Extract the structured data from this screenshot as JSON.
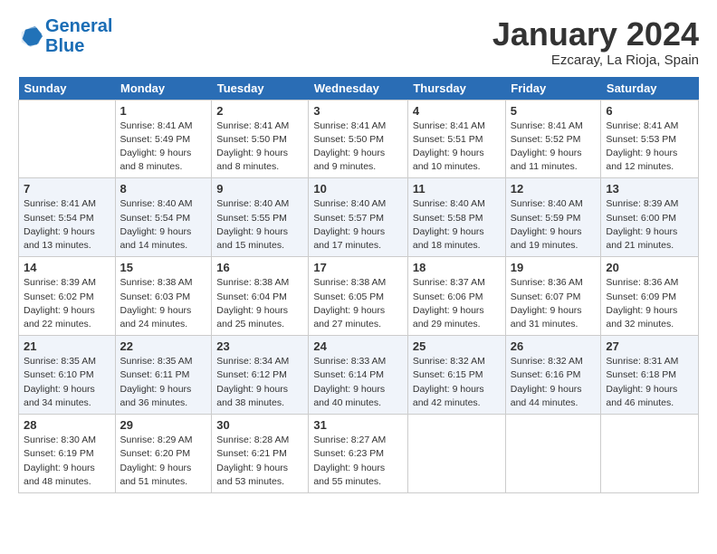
{
  "header": {
    "logo_line1": "General",
    "logo_line2": "Blue",
    "month_title": "January 2024",
    "location": "Ezcaray, La Rioja, Spain"
  },
  "weekdays": [
    "Sunday",
    "Monday",
    "Tuesday",
    "Wednesday",
    "Thursday",
    "Friday",
    "Saturday"
  ],
  "weeks": [
    [
      {
        "day": "",
        "info": ""
      },
      {
        "day": "1",
        "info": "Sunrise: 8:41 AM\nSunset: 5:49 PM\nDaylight: 9 hours\nand 8 minutes."
      },
      {
        "day": "2",
        "info": "Sunrise: 8:41 AM\nSunset: 5:50 PM\nDaylight: 9 hours\nand 8 minutes."
      },
      {
        "day": "3",
        "info": "Sunrise: 8:41 AM\nSunset: 5:50 PM\nDaylight: 9 hours\nand 9 minutes."
      },
      {
        "day": "4",
        "info": "Sunrise: 8:41 AM\nSunset: 5:51 PM\nDaylight: 9 hours\nand 10 minutes."
      },
      {
        "day": "5",
        "info": "Sunrise: 8:41 AM\nSunset: 5:52 PM\nDaylight: 9 hours\nand 11 minutes."
      },
      {
        "day": "6",
        "info": "Sunrise: 8:41 AM\nSunset: 5:53 PM\nDaylight: 9 hours\nand 12 minutes."
      }
    ],
    [
      {
        "day": "7",
        "info": ""
      },
      {
        "day": "8",
        "info": "Sunrise: 8:40 AM\nSunset: 5:54 PM\nDaylight: 9 hours\nand 14 minutes."
      },
      {
        "day": "9",
        "info": "Sunrise: 8:40 AM\nSunset: 5:55 PM\nDaylight: 9 hours\nand 15 minutes."
      },
      {
        "day": "10",
        "info": "Sunrise: 8:40 AM\nSunset: 5:57 PM\nDaylight: 9 hours\nand 17 minutes."
      },
      {
        "day": "11",
        "info": "Sunrise: 8:40 AM\nSunset: 5:58 PM\nDaylight: 9 hours\nand 18 minutes."
      },
      {
        "day": "12",
        "info": "Sunrise: 8:40 AM\nSunset: 5:59 PM\nDaylight: 9 hours\nand 19 minutes."
      },
      {
        "day": "13",
        "info": "Sunrise: 8:39 AM\nSunset: 6:00 PM\nDaylight: 9 hours\nand 21 minutes."
      }
    ],
    [
      {
        "day": "14",
        "info": ""
      },
      {
        "day": "15",
        "info": "Sunrise: 8:38 AM\nSunset: 6:03 PM\nDaylight: 9 hours\nand 24 minutes."
      },
      {
        "day": "16",
        "info": "Sunrise: 8:38 AM\nSunset: 6:04 PM\nDaylight: 9 hours\nand 25 minutes."
      },
      {
        "day": "17",
        "info": "Sunrise: 8:38 AM\nSunset: 6:05 PM\nDaylight: 9 hours\nand 27 minutes."
      },
      {
        "day": "18",
        "info": "Sunrise: 8:37 AM\nSunset: 6:06 PM\nDaylight: 9 hours\nand 29 minutes."
      },
      {
        "day": "19",
        "info": "Sunrise: 8:36 AM\nSunset: 6:07 PM\nDaylight: 9 hours\nand 31 minutes."
      },
      {
        "day": "20",
        "info": "Sunrise: 8:36 AM\nSunset: 6:09 PM\nDaylight: 9 hours\nand 32 minutes."
      }
    ],
    [
      {
        "day": "21",
        "info": ""
      },
      {
        "day": "22",
        "info": "Sunrise: 8:35 AM\nSunset: 6:11 PM\nDaylight: 9 hours\nand 36 minutes."
      },
      {
        "day": "23",
        "info": "Sunrise: 8:34 AM\nSunset: 6:12 PM\nDaylight: 9 hours\nand 38 minutes."
      },
      {
        "day": "24",
        "info": "Sunrise: 8:33 AM\nSunset: 6:14 PM\nDaylight: 9 hours\nand 40 minutes."
      },
      {
        "day": "25",
        "info": "Sunrise: 8:32 AM\nSunset: 6:15 PM\nDaylight: 9 hours\nand 42 minutes."
      },
      {
        "day": "26",
        "info": "Sunrise: 8:32 AM\nSunset: 6:16 PM\nDaylight: 9 hours\nand 44 minutes."
      },
      {
        "day": "27",
        "info": "Sunrise: 8:31 AM\nSunset: 6:18 PM\nDaylight: 9 hours\nand 46 minutes."
      }
    ],
    [
      {
        "day": "28",
        "info": "Sunrise: 8:30 AM\nSunset: 6:19 PM\nDaylight: 9 hours\nand 48 minutes."
      },
      {
        "day": "29",
        "info": "Sunrise: 8:29 AM\nSunset: 6:20 PM\nDaylight: 9 hours\nand 51 minutes."
      },
      {
        "day": "30",
        "info": "Sunrise: 8:28 AM\nSunset: 6:21 PM\nDaylight: 9 hours\nand 53 minutes."
      },
      {
        "day": "31",
        "info": "Sunrise: 8:27 AM\nSunset: 6:23 PM\nDaylight: 9 hours\nand 55 minutes."
      },
      {
        "day": "",
        "info": ""
      },
      {
        "day": "",
        "info": ""
      },
      {
        "day": "",
        "info": ""
      }
    ]
  ],
  "day14_info": "Sunrise: 8:39 AM\nSunset: 6:02 PM\nDaylight: 9 hours\nand 22 minutes.",
  "day7_info": "Sunrise: 8:41 AM\nSunset: 5:54 PM\nDaylight: 9 hours\nand 13 minutes.",
  "day21_info": "Sunrise: 8:35 AM\nSunset: 6:10 PM\nDaylight: 9 hours\nand 34 minutes."
}
